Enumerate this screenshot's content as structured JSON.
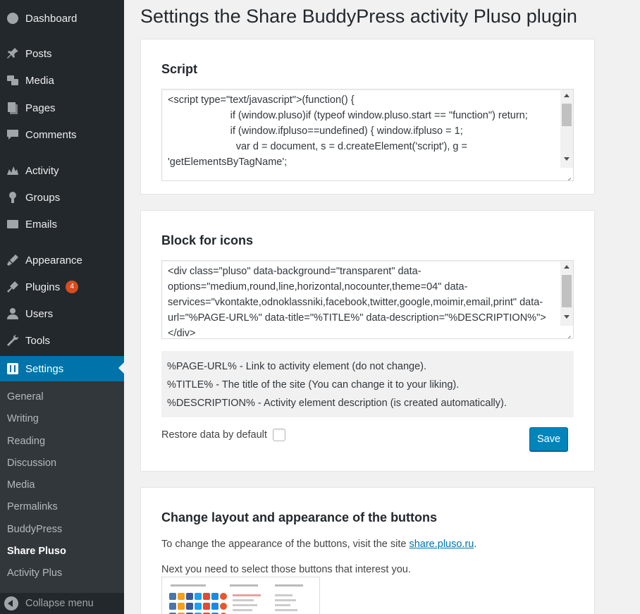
{
  "sidebar": {
    "menu": [
      {
        "label": "Dashboard",
        "icon": "dashboard-icon"
      },
      {
        "label": "Posts",
        "icon": "pin-icon"
      },
      {
        "label": "Media",
        "icon": "media-icon"
      },
      {
        "label": "Pages",
        "icon": "pages-icon"
      },
      {
        "label": "Comments",
        "icon": "comments-icon"
      },
      {
        "label": "Activity",
        "icon": "activity-icon"
      },
      {
        "label": "Groups",
        "icon": "groups-icon"
      },
      {
        "label": "Emails",
        "icon": "email-icon"
      },
      {
        "label": "Appearance",
        "icon": "brush-icon"
      },
      {
        "label": "Plugins",
        "icon": "plugin-icon",
        "badge": "4"
      },
      {
        "label": "Users",
        "icon": "user-icon"
      },
      {
        "label": "Tools",
        "icon": "wrench-icon"
      },
      {
        "label": "Settings",
        "icon": "settings-icon"
      }
    ],
    "submenu": [
      "General",
      "Writing",
      "Reading",
      "Discussion",
      "Media",
      "Permalinks",
      "BuddyPress",
      "Share Pluso",
      "Activity Plus"
    ],
    "current_submenu": "Share Pluso",
    "collapse_label": "Collapse menu"
  },
  "page": {
    "title": "Settings the Share BuddyPress activity Pluso plugin"
  },
  "script_card": {
    "heading": "Script",
    "code": "<script type=\"text/javascript\">(function() {\n                      if (window.pluso)if (typeof window.pluso.start == \"function\") return;\n                      if (window.ifpluso==undefined) { window.ifpluso = 1;\n                        var d = document, s = d.createElement('script'), g = 'getElementsByTagName';"
  },
  "icons_card": {
    "heading": "Block for icons",
    "code": "<div class=\"pluso\" data-background=\"transparent\" data-options=\"medium,round,line,horizontal,nocounter,theme=04\" data-services=\"vkontakte,odnoklassniki,facebook,twitter,google,moimir,email,print\" data-url=\"%PAGE-URL%\" data-title=\"%TITLE%\" data-description=\"%DESCRIPTION%\"></div>",
    "help": [
      "%PAGE-URL% - Link to activity element (do not change).",
      "%TITLE% - The title of the site (You can change it to your liking).",
      "%DESCRIPTION% - Activity element description (is created automatically)."
    ],
    "restore_label": "Restore data by default",
    "save_label": "Save"
  },
  "layout_card": {
    "heading": "Change layout and appearance of the buttons",
    "para1_prefix": "To change the appearance of the buttons, visit the site ",
    "para1_link": "share.pluso.ru",
    "para1_suffix": ".",
    "para2": "Next you need to select those buttons that interest you."
  },
  "colors": {
    "sidebar_bg": "#23282d",
    "submenu_bg": "#32373c",
    "accent": "#0073aa",
    "button": "#0085ba",
    "badge": "#d54e21"
  }
}
